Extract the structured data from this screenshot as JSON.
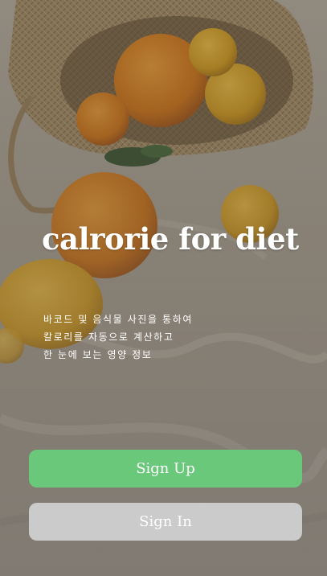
{
  "app": {
    "title": "calrorie for diet",
    "description_lines": [
      "바코드 및 음식물 사진을 통하여",
      "칼로리를 자동으로 계산하고",
      "한 눈에 보는 영양 정보"
    ]
  },
  "buttons": {
    "sign_up": {
      "label": "Sign Up",
      "color": "#6ac87a"
    },
    "sign_in": {
      "label": "Sign In",
      "color": "#cbcbcb"
    }
  }
}
